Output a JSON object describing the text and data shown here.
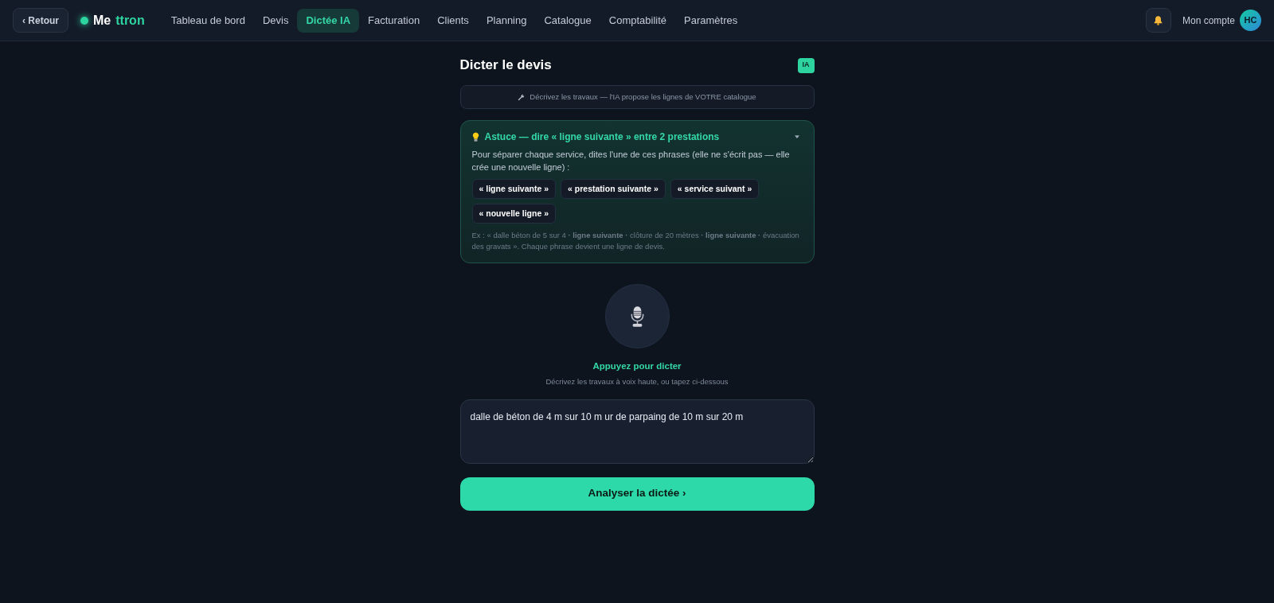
{
  "nav": {
    "back_button": "‹ Retour",
    "logo": {
      "first": "Me",
      "second": "ttron"
    },
    "tabs": [
      {
        "label": "Tableau de bord",
        "selected": false
      },
      {
        "label": "Devis",
        "selected": false
      },
      {
        "label": "Dictée IA",
        "selected": true
      },
      {
        "label": "Facturation",
        "selected": false
      },
      {
        "label": "Clients",
        "selected": false
      },
      {
        "label": "Planning",
        "selected": false
      },
      {
        "label": "Catalogue",
        "selected": false
      },
      {
        "label": "Comptabilité",
        "selected": false
      },
      {
        "label": "Paramètres",
        "selected": false
      }
    ],
    "account": {
      "label": "Mon compte",
      "initials": "HC"
    }
  },
  "page": {
    "title": "Dicter le devis",
    "badge": "IA",
    "info": "Décrivez les travaux — l'IA propose les lignes de VOTRE catalogue"
  },
  "tip": {
    "title": "Astuce — dire « ligne suivante » entre 2 prestations",
    "expanded": true,
    "text": "Pour séparer chaque service, dites l'une de ces phrases (elle ne s'écrit pas — elle crée une nouvelle ligne) :",
    "phrases": [
      "« ligne suivante »",
      "« prestation suivante »",
      "« service suivant »",
      "« nouvelle ligne »"
    ],
    "example": "Ex : « dalle béton de 5 sur 4 **· ligne suivante ·** clôture de 20 mètres **· ligne suivante ·** évacuation des gravats ». Chaque phrase devient une ligne de devis."
  },
  "dictation": {
    "prompt": "Appuyez pour dicter",
    "hint": "Décrivez les travaux à voix haute, ou tapez ci-dessous",
    "field": {
      "value": "dalle de béton de 4 m sur 10 m ur de parpaing de 10 m sur 20 m"
    }
  },
  "submit_button": "Analyser la dictée ›"
}
